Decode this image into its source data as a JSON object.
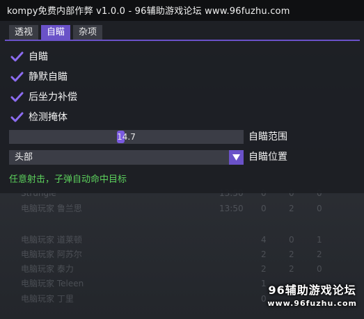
{
  "window": {
    "title": "kompy免费内部作弊 v1.0.0 - 96辅助游戏论坛 www.96fuzhu.com"
  },
  "tabs": [
    {
      "label": "透视",
      "active": false
    },
    {
      "label": "自瞄",
      "active": true
    },
    {
      "label": "杂项",
      "active": false
    }
  ],
  "checkboxes": [
    {
      "label": "自瞄",
      "checked": true
    },
    {
      "label": "静默自瞄",
      "checked": true
    },
    {
      "label": "后坐力补偿",
      "checked": true
    },
    {
      "label": "检测掩体",
      "checked": true
    }
  ],
  "slider": {
    "value": "14.7",
    "label": "自瞄范围"
  },
  "combo": {
    "value": "头部",
    "label": "自瞄位置"
  },
  "hint": "任意射击，子弹自动命中目标",
  "watermark": {
    "title": "96辅助游戏论坛",
    "url": "www.96fuzhu.com"
  },
  "colors": {
    "accent": "#6a52c8",
    "hint": "#5cd05c"
  }
}
